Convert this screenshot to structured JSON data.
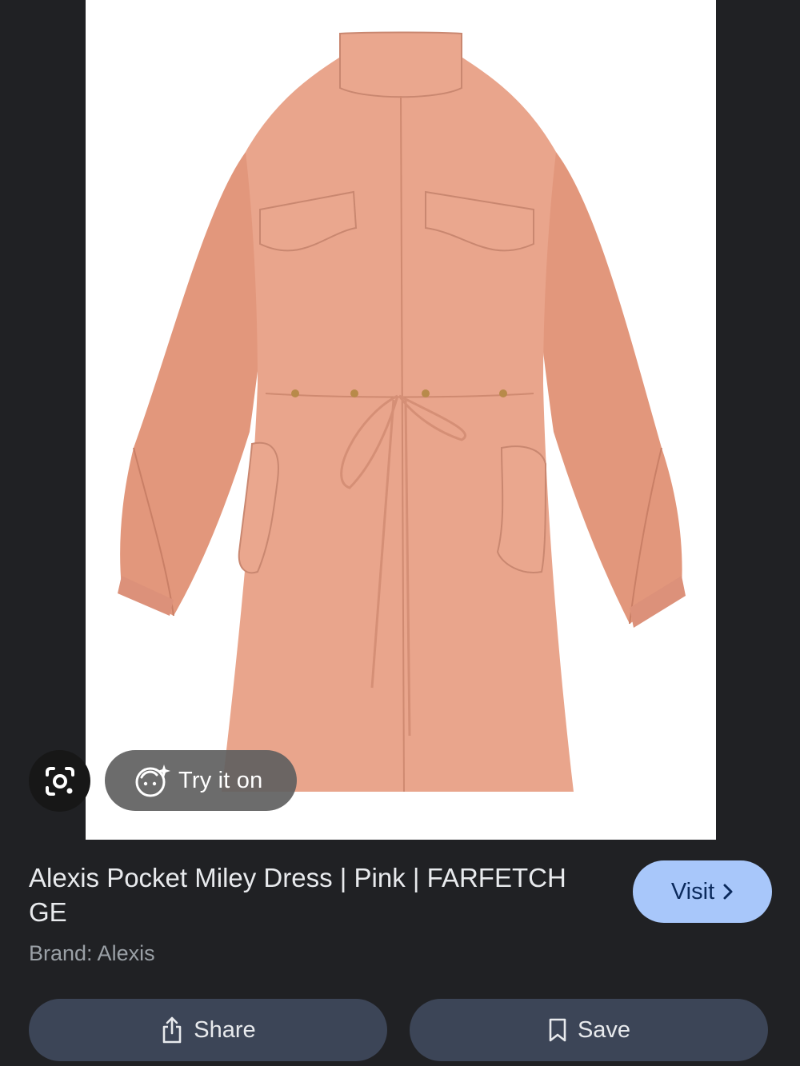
{
  "product": {
    "title": "Alexis Pocket Miley Dress | Pink | FARFETCH GE",
    "brand_line": "Brand: Alexis",
    "image_alt": "Alexis Pocket Miley Dress",
    "image_color": "#e9a58c"
  },
  "overlay": {
    "lens_icon": "google-lens-icon",
    "try_on_label": "Try it on",
    "try_on_icon": "sparkle-face-icon"
  },
  "actions": {
    "visit_label": "Visit",
    "share_label": "Share",
    "save_label": "Save"
  },
  "colors": {
    "background": "#202124",
    "visit_button": "#a8c7fa",
    "action_button": "#3c4557"
  }
}
